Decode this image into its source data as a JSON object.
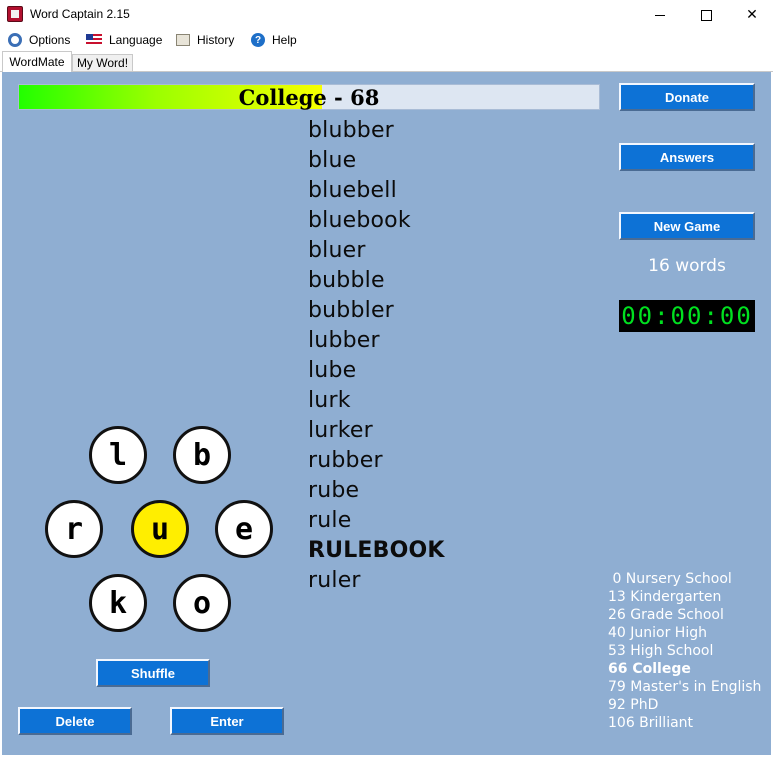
{
  "window": {
    "title": "Word Captain 2.15",
    "minimize": "",
    "maximize": "",
    "close": "✕"
  },
  "menu": {
    "items": [
      {
        "label": "Options",
        "icon": "gear-icon"
      },
      {
        "label": "Language",
        "icon": "flag-icon"
      },
      {
        "label": "History",
        "icon": "history-icon"
      },
      {
        "label": "Help",
        "icon": "help-icon"
      }
    ]
  },
  "tabs": [
    {
      "label": "WordMate",
      "active": true
    },
    {
      "label": "My Word!",
      "active": false
    }
  ],
  "progress": {
    "level": "College",
    "separator": " - ",
    "score": "68",
    "fill_fraction": 0.522
  },
  "buttons": {
    "donate": "Donate",
    "answers": "Answers",
    "new_game": "New Game",
    "shuffle": "Shuffle",
    "delete": "Delete",
    "enter": "Enter"
  },
  "words": [
    {
      "text": "blubber",
      "bold": false
    },
    {
      "text": "blue",
      "bold": false
    },
    {
      "text": "bluebell",
      "bold": false
    },
    {
      "text": "bluebook",
      "bold": false
    },
    {
      "text": "bluer",
      "bold": false
    },
    {
      "text": "bubble",
      "bold": false
    },
    {
      "text": "bubbler",
      "bold": false
    },
    {
      "text": "lubber",
      "bold": false
    },
    {
      "text": "lube",
      "bold": false
    },
    {
      "text": "lurk",
      "bold": false
    },
    {
      "text": "lurker",
      "bold": false
    },
    {
      "text": "rubber",
      "bold": false
    },
    {
      "text": "rube",
      "bold": false
    },
    {
      "text": "rule",
      "bold": false
    },
    {
      "text": "RULEBOOK",
      "bold": true
    },
    {
      "text": "ruler",
      "bold": false
    }
  ],
  "word_count": "16 words",
  "timer": "00:00:00",
  "letters": {
    "l": "l",
    "b": "b",
    "r": "r",
    "u": "u",
    "e": "e",
    "k": "k",
    "o": "o"
  },
  "levels": [
    {
      "text": " 0 Nursery School",
      "current": false
    },
    {
      "text": "13 Kindergarten",
      "current": false
    },
    {
      "text": "26 Grade School",
      "current": false
    },
    {
      "text": "40 Junior High",
      "current": false
    },
    {
      "text": "53 High School",
      "current": false
    },
    {
      "text": "66 College",
      "current": true
    },
    {
      "text": "79 Master's in English",
      "current": false
    },
    {
      "text": "92 PhD",
      "current": false
    },
    {
      "text": "106 Brilliant",
      "current": false
    }
  ],
  "colors": {
    "panel_bg": "#8faed2",
    "button_blue": "#0d72d6",
    "center_letter": "#ffee00",
    "timer_green": "#00e020"
  }
}
